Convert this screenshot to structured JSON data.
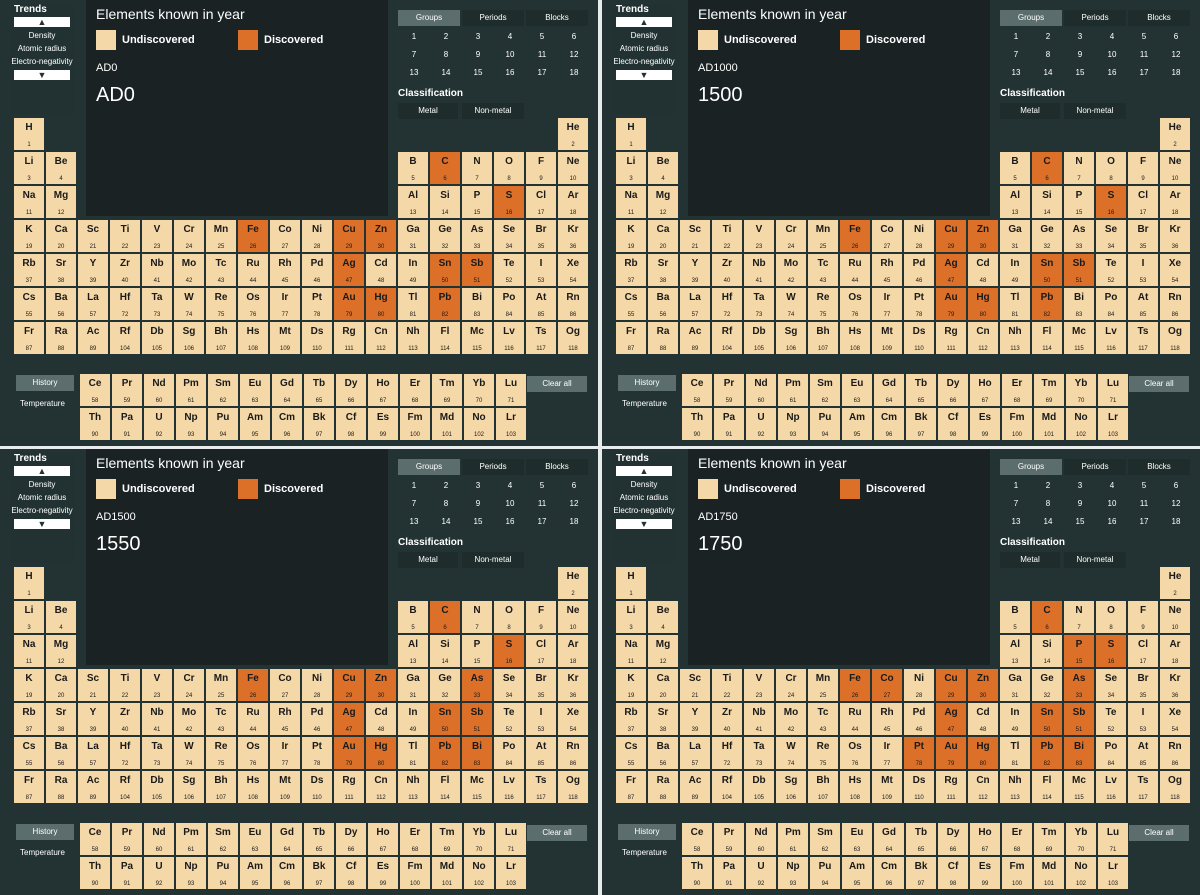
{
  "sidebar": {
    "title": "Trends",
    "items": [
      "Density",
      "Atomic radius",
      "Electro-\nnegativity"
    ],
    "up": "^",
    "down": "v"
  },
  "display": {
    "title": "Elements known in year",
    "legend": {
      "undiscovered": "Undiscovered",
      "discovered": "Discovered"
    }
  },
  "tabs": [
    "Groups",
    "Periods",
    "Blocks"
  ],
  "groups": [
    "1",
    "2",
    "3",
    "4",
    "5",
    "6",
    "7",
    "8",
    "9",
    "10",
    "11",
    "12",
    "13",
    "14",
    "15",
    "16",
    "17",
    "18"
  ],
  "classification": {
    "title": "Classification",
    "metal": "Metal",
    "nonmetal": "Non-metal"
  },
  "bottom": {
    "history": "History",
    "temperature": "Temperature",
    "clear": "Clear all"
  },
  "colors": {
    "undiscovered": "#f5d8a8",
    "discovered": "#dd7028"
  },
  "elements": [
    [
      "H",
      1,
      1,
      1
    ],
    [
      "He",
      2,
      1,
      18
    ],
    [
      "Li",
      3,
      2,
      1
    ],
    [
      "Be",
      4,
      2,
      2
    ],
    [
      "B",
      5,
      2,
      13
    ],
    [
      "C",
      6,
      2,
      14
    ],
    [
      "N",
      7,
      2,
      15
    ],
    [
      "O",
      8,
      2,
      16
    ],
    [
      "F",
      9,
      2,
      17
    ],
    [
      "Ne",
      10,
      2,
      18
    ],
    [
      "Na",
      11,
      3,
      1
    ],
    [
      "Mg",
      12,
      3,
      2
    ],
    [
      "Al",
      13,
      3,
      13
    ],
    [
      "Si",
      14,
      3,
      14
    ],
    [
      "P",
      15,
      3,
      15
    ],
    [
      "S",
      16,
      3,
      16
    ],
    [
      "Cl",
      17,
      3,
      17
    ],
    [
      "Ar",
      18,
      3,
      18
    ],
    [
      "K",
      19,
      4,
      1
    ],
    [
      "Ca",
      20,
      4,
      2
    ],
    [
      "Sc",
      21,
      4,
      3
    ],
    [
      "Ti",
      22,
      4,
      4
    ],
    [
      "V",
      23,
      4,
      5
    ],
    [
      "Cr",
      24,
      4,
      6
    ],
    [
      "Mn",
      25,
      4,
      7
    ],
    [
      "Fe",
      26,
      4,
      8
    ],
    [
      "Co",
      27,
      4,
      9
    ],
    [
      "Ni",
      28,
      4,
      10
    ],
    [
      "Cu",
      29,
      4,
      11
    ],
    [
      "Zn",
      30,
      4,
      12
    ],
    [
      "Ga",
      31,
      4,
      13
    ],
    [
      "Ge",
      32,
      4,
      14
    ],
    [
      "As",
      33,
      4,
      15
    ],
    [
      "Se",
      34,
      4,
      16
    ],
    [
      "Br",
      35,
      4,
      17
    ],
    [
      "Kr",
      36,
      4,
      18
    ],
    [
      "Rb",
      37,
      5,
      1
    ],
    [
      "Sr",
      38,
      5,
      2
    ],
    [
      "Y",
      39,
      5,
      3
    ],
    [
      "Zr",
      40,
      5,
      4
    ],
    [
      "Nb",
      41,
      5,
      5
    ],
    [
      "Mo",
      42,
      5,
      6
    ],
    [
      "Tc",
      43,
      5,
      7
    ],
    [
      "Ru",
      44,
      5,
      8
    ],
    [
      "Rh",
      45,
      5,
      9
    ],
    [
      "Pd",
      46,
      5,
      10
    ],
    [
      "Ag",
      47,
      5,
      11
    ],
    [
      "Cd",
      48,
      5,
      12
    ],
    [
      "In",
      49,
      5,
      13
    ],
    [
      "Sn",
      50,
      5,
      14
    ],
    [
      "Sb",
      51,
      5,
      15
    ],
    [
      "Te",
      52,
      5,
      16
    ],
    [
      "I",
      53,
      5,
      17
    ],
    [
      "Xe",
      54,
      5,
      18
    ],
    [
      "Cs",
      55,
      6,
      1
    ],
    [
      "Ba",
      56,
      6,
      2
    ],
    [
      "La",
      57,
      6,
      3
    ],
    [
      "Hf",
      72,
      6,
      4
    ],
    [
      "Ta",
      73,
      6,
      5
    ],
    [
      "W",
      74,
      6,
      6
    ],
    [
      "Re",
      75,
      6,
      7
    ],
    [
      "Os",
      76,
      6,
      8
    ],
    [
      "Ir",
      77,
      6,
      9
    ],
    [
      "Pt",
      78,
      6,
      10
    ],
    [
      "Au",
      79,
      6,
      11
    ],
    [
      "Hg",
      80,
      6,
      12
    ],
    [
      "Tl",
      81,
      6,
      13
    ],
    [
      "Pb",
      82,
      6,
      14
    ],
    [
      "Bi",
      83,
      6,
      15
    ],
    [
      "Po",
      84,
      6,
      16
    ],
    [
      "At",
      85,
      6,
      17
    ],
    [
      "Rn",
      86,
      6,
      18
    ],
    [
      "Fr",
      87,
      7,
      1
    ],
    [
      "Ra",
      88,
      7,
      2
    ],
    [
      "Ac",
      89,
      7,
      3
    ],
    [
      "Rf",
      104,
      7,
      4
    ],
    [
      "Db",
      105,
      7,
      5
    ],
    [
      "Sg",
      106,
      7,
      6
    ],
    [
      "Bh",
      107,
      7,
      7
    ],
    [
      "Hs",
      108,
      7,
      8
    ],
    [
      "Mt",
      109,
      7,
      9
    ],
    [
      "Ds",
      110,
      7,
      10
    ],
    [
      "Rg",
      111,
      7,
      11
    ],
    [
      "Cn",
      112,
      7,
      12
    ],
    [
      "Nh",
      113,
      7,
      13
    ],
    [
      "Fl",
      114,
      7,
      14
    ],
    [
      "Mc",
      115,
      7,
      15
    ],
    [
      "Lv",
      116,
      7,
      16
    ],
    [
      "Ts",
      117,
      7,
      17
    ],
    [
      "Og",
      118,
      7,
      18
    ]
  ],
  "lanthanides": [
    [
      "Ce",
      58
    ],
    [
      "Pr",
      59
    ],
    [
      "Nd",
      60
    ],
    [
      "Pm",
      61
    ],
    [
      "Sm",
      62
    ],
    [
      "Eu",
      63
    ],
    [
      "Gd",
      64
    ],
    [
      "Tb",
      65
    ],
    [
      "Dy",
      66
    ],
    [
      "Ho",
      67
    ],
    [
      "Er",
      68
    ],
    [
      "Tm",
      69
    ],
    [
      "Yb",
      70
    ],
    [
      "Lu",
      71
    ]
  ],
  "actinides": [
    [
      "Th",
      90
    ],
    [
      "Pa",
      91
    ],
    [
      "U",
      92
    ],
    [
      "Np",
      93
    ],
    [
      "Pu",
      94
    ],
    [
      "Am",
      95
    ],
    [
      "Cm",
      96
    ],
    [
      "Bk",
      97
    ],
    [
      "Cf",
      98
    ],
    [
      "Es",
      99
    ],
    [
      "Fm",
      100
    ],
    [
      "Md",
      101
    ],
    [
      "No",
      102
    ],
    [
      "Lr",
      103
    ]
  ],
  "panels": [
    {
      "year_small": "AD0",
      "year_big": "AD0",
      "discovered": [
        6,
        16,
        26,
        29,
        30,
        47,
        50,
        51,
        79,
        80,
        82
      ]
    },
    {
      "year_small": "AD1000",
      "year_big": "1500",
      "discovered": [
        6,
        16,
        26,
        29,
        30,
        47,
        50,
        51,
        79,
        80,
        82
      ]
    },
    {
      "year_small": "AD1500",
      "year_big": "1550",
      "discovered": [
        6,
        16,
        26,
        29,
        30,
        33,
        47,
        50,
        51,
        79,
        80,
        82,
        83
      ]
    },
    {
      "year_small": "AD1750",
      "year_big": "1750",
      "discovered": [
        6,
        15,
        16,
        26,
        27,
        29,
        30,
        33,
        47,
        50,
        51,
        78,
        79,
        80,
        82,
        83
      ]
    }
  ]
}
